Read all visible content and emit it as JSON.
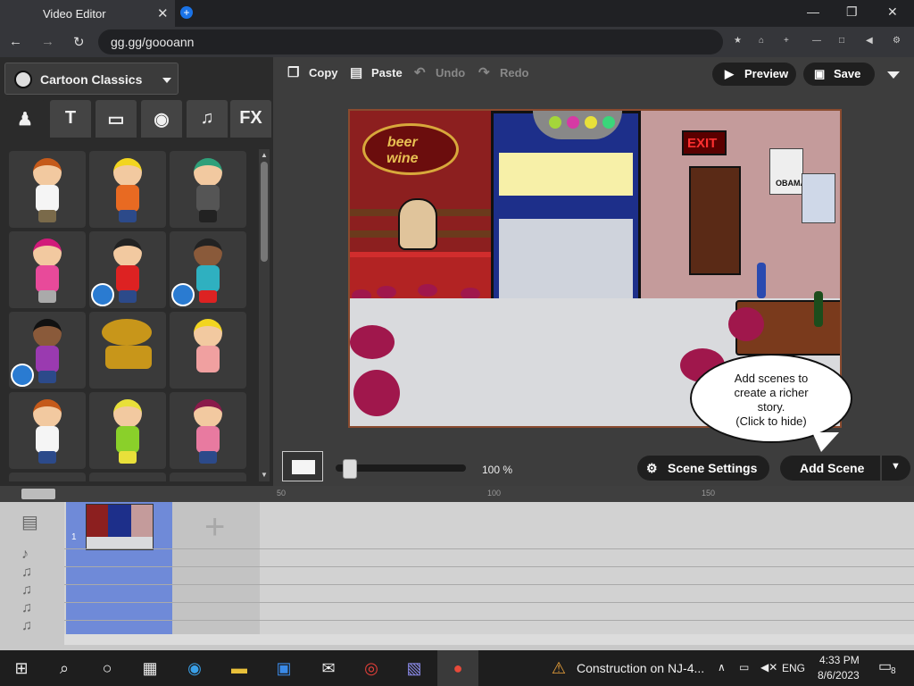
{
  "browser": {
    "tab_title": "Video Editor",
    "tab_close": "✕",
    "new_tab": "+",
    "url": "gg.gg/goooann",
    "win_min": "—",
    "win_restore": "❐",
    "win_close": "✕"
  },
  "editor": {
    "theme": "Cartoon Classics",
    "categories": [
      {
        "icon": "person-icon",
        "glyph": "♟"
      },
      {
        "icon": "text-bubble-icon",
        "glyph": "T"
      },
      {
        "icon": "background-icon",
        "glyph": "▭"
      },
      {
        "icon": "prop-ball-icon",
        "glyph": "◉"
      },
      {
        "icon": "music-icon",
        "glyph": "♫"
      },
      {
        "icon": "fx-icon",
        "glyph": "FX"
      }
    ],
    "toolbar": {
      "copy": "Copy",
      "paste": "Paste",
      "undo": "Undo",
      "redo": "Redo",
      "preview": "Preview",
      "save": "Save"
    },
    "stage": {
      "sign_line1": "beer",
      "sign_line2": "wine",
      "exit": "EXIT",
      "poster": "OBAMA"
    },
    "tip": {
      "line1": "Add scenes to",
      "line2": "create a richer",
      "line3": "story.",
      "line4": "(Click to hide)"
    },
    "zoom": "100 %",
    "scene_settings": "Scene Settings",
    "add_scene": "Add Scene"
  },
  "timeline": {
    "ticks": [
      "50",
      "100",
      "150"
    ],
    "scene_number": "1"
  },
  "taskbar": {
    "news": "Construction on NJ-4...",
    "lang": "ENG",
    "time": "4:33 PM",
    "date": "8/6/2023",
    "notifications": "8"
  }
}
